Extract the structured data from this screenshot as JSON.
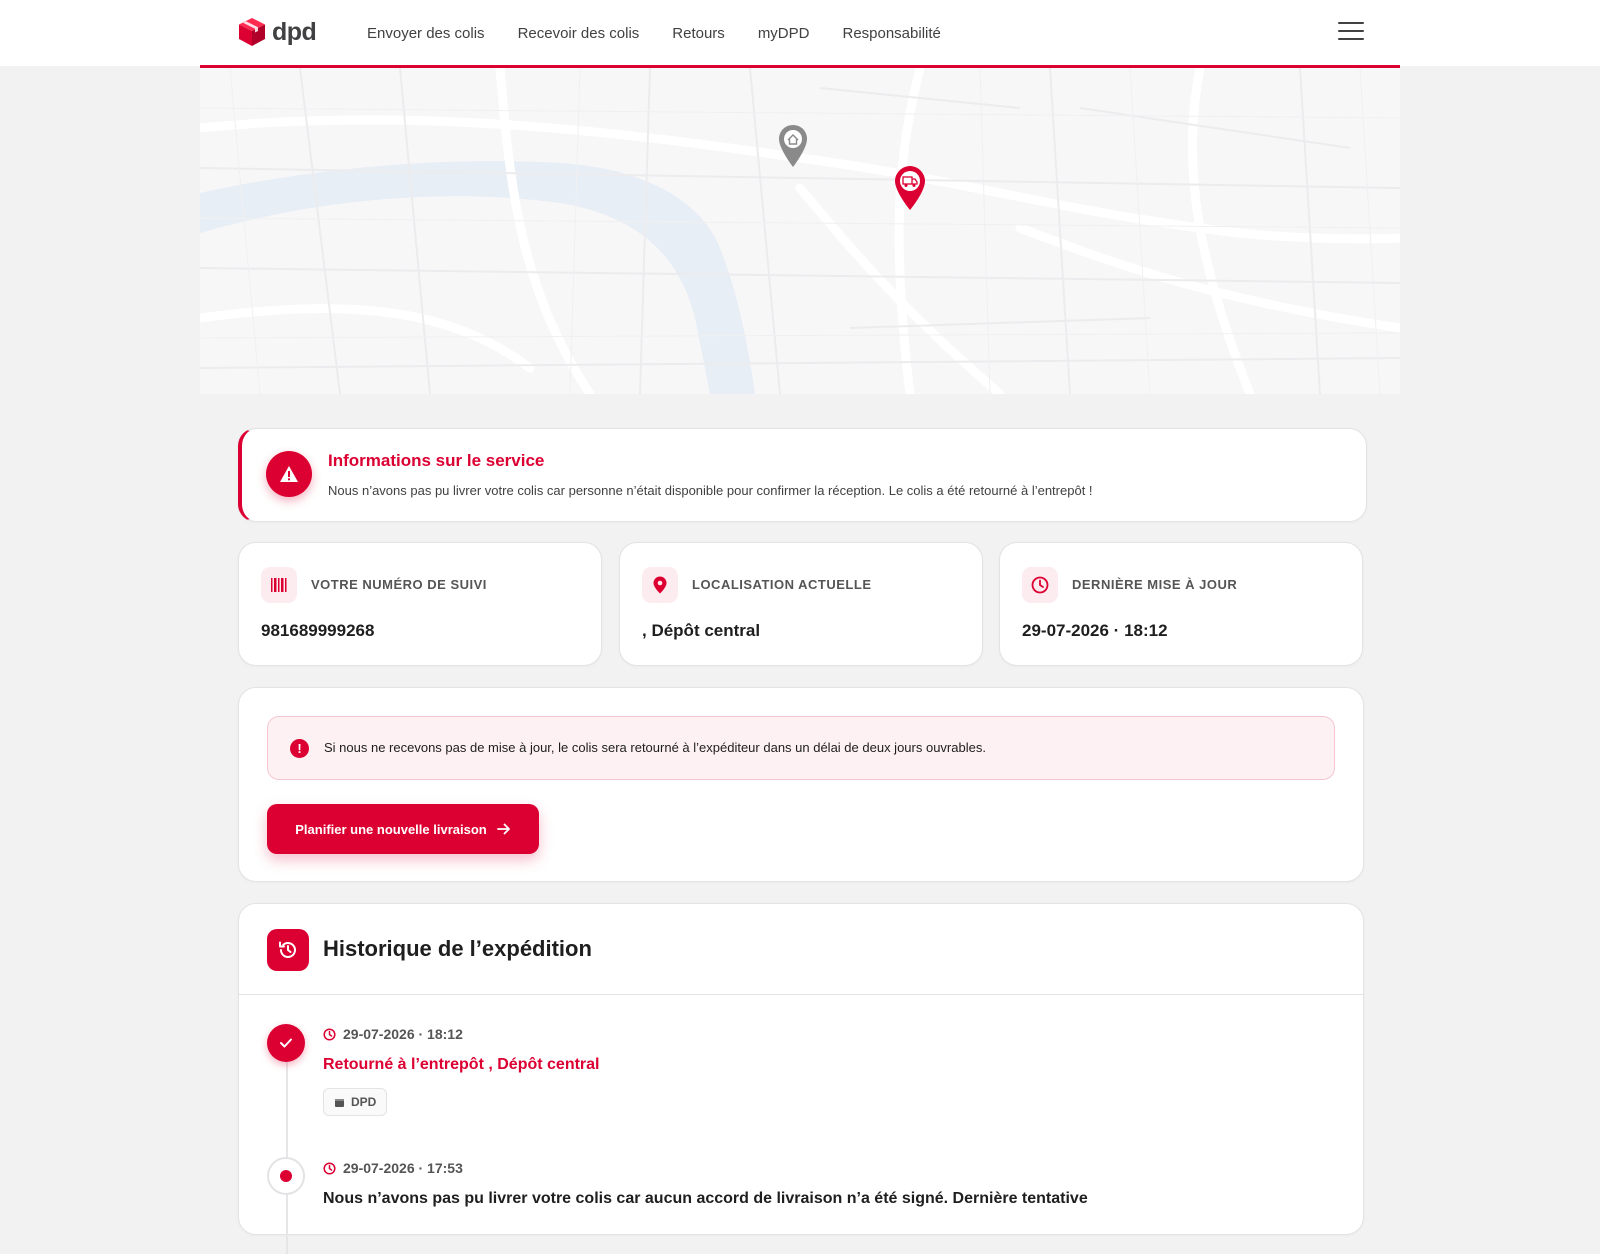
{
  "header": {
    "logo_text": "dpd",
    "nav": [
      "Envoyer des colis",
      "Recevoir des colis",
      "Retours",
      "myDPD",
      "Responsabilité"
    ]
  },
  "service_info": {
    "title": "Informations sur le service",
    "text": "Nous n’avons pas pu livrer votre colis car personne n’était disponible pour confirmer la réception. Le colis a été retourné à l’entrepôt !"
  },
  "info_cards": [
    {
      "label": "VOTRE NUMÉRO DE SUIVI",
      "value": "981689999268",
      "icon": "barcode-icon"
    },
    {
      "label": "LOCALISATION ACTUELLE",
      "value": ", Dépôt central",
      "icon": "location-pin-icon"
    },
    {
      "label": "DERNIÈRE MISE À JOUR",
      "value": "29-07-2026 · 18:12",
      "icon": "clock-icon"
    }
  ],
  "alert": {
    "text": "Si nous ne recevons pas de mise à jour, le colis sera retourné à l’expéditeur dans un délai de deux jours ouvrables."
  },
  "cta": {
    "label": "Planifier une nouvelle livraison"
  },
  "history": {
    "title": "Historique de l’expédition",
    "events": [
      {
        "time": "29-07-2026 · 18:12",
        "title": "Retourné à l’entrepôt , Dépôt central",
        "tag": "DPD"
      },
      {
        "time": "29-07-2026 · 17:53",
        "title": "Nous n’avons pas pu livrer votre colis car aucun accord de livraison n’a été signé. Dernière tentative"
      }
    ]
  },
  "colors": {
    "brand": "#dc0032",
    "text": "#1e1e1e",
    "muted": "#414042"
  }
}
